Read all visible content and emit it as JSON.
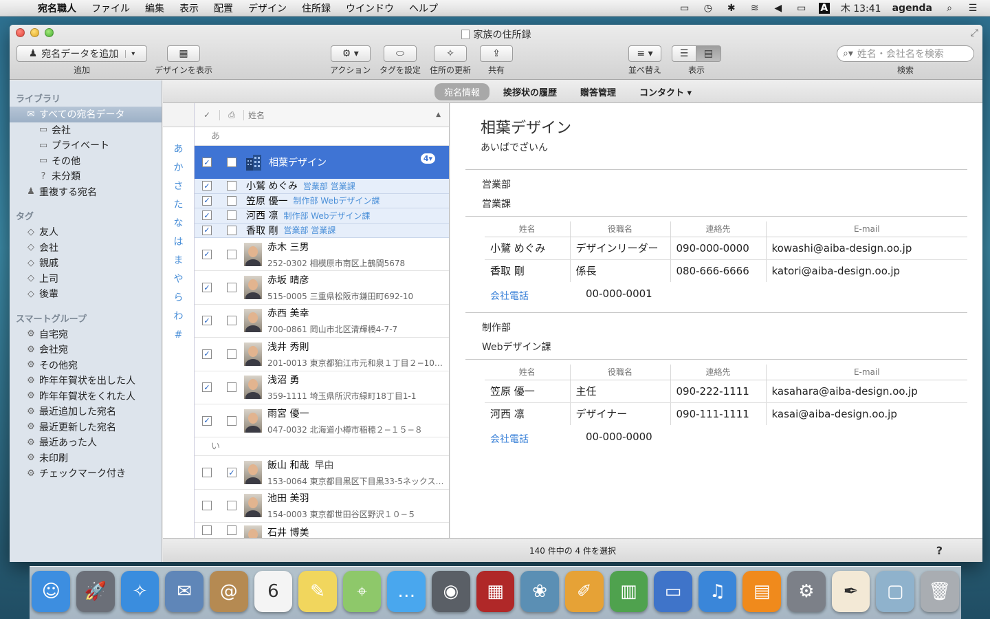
{
  "menubar": {
    "app": "宛名職人",
    "items": [
      "ファイル",
      "編集",
      "表示",
      "配置",
      "デザイン",
      "住所録",
      "ウインドウ",
      "ヘルプ"
    ],
    "clock": "木 13:41",
    "user": "agenda",
    "input_source": "A"
  },
  "window": {
    "title": "家族の住所録"
  },
  "toolbar": {
    "add_button": "宛名データを追加",
    "add_label": "追加",
    "design_label": "デザインを表示",
    "action_label": "アクション",
    "tag_label": "タグを設定",
    "update_label": "住所の更新",
    "share_label": "共有",
    "sort_label": "並べ替え",
    "view_label": "表示",
    "search_placeholder": "姓名・会社名を検索",
    "search_label": "検索"
  },
  "sidebar": {
    "library_head": "ライブラリ",
    "library": [
      {
        "label": "すべての宛名データ",
        "icon": "envelope-icon",
        "selected": true,
        "indent": 1
      },
      {
        "label": "会社",
        "icon": "folder-icon",
        "indent": 2
      },
      {
        "label": "プライベート",
        "icon": "folder-icon",
        "indent": 2
      },
      {
        "label": "その他",
        "icon": "folder-icon",
        "indent": 2
      },
      {
        "label": "未分類",
        "icon": "question-icon",
        "indent": 2
      },
      {
        "label": "重複する宛名",
        "icon": "people-icon",
        "indent": 1
      }
    ],
    "tags_head": "タグ",
    "tags": [
      "友人",
      "会社",
      "親戚",
      "上司",
      "後輩"
    ],
    "smart_head": "スマートグループ",
    "smart": [
      "自宅宛",
      "会社宛",
      "その他宛",
      "昨年年賀状を出した人",
      "昨年年賀状をくれた人",
      "最近追加した宛名",
      "最近更新した宛名",
      "最近あった人",
      "未印刷",
      "チェックマーク付き"
    ]
  },
  "tabs": [
    {
      "label": "宛名情報",
      "active": true
    },
    {
      "label": "挨拶状の履歴",
      "active": false
    },
    {
      "label": "贈答管理",
      "active": false
    },
    {
      "label": "コンタクト ▾",
      "active": false
    }
  ],
  "index": [
    "あ",
    "か",
    "さ",
    "た",
    "な",
    "は",
    "ま",
    "や",
    "ら",
    "わ",
    "#"
  ],
  "list": {
    "header_name": "姓名",
    "section_a": "あ",
    "section_i": "い",
    "selected": {
      "name": "相葉デザイン",
      "badge": "4▾",
      "checked": true
    },
    "members": [
      {
        "name": "小鷲 めぐみ",
        "dept": "営業部 営業課"
      },
      {
        "name": "笠原 優一",
        "dept": "制作部 Webデザイン課"
      },
      {
        "name": "河西 凛",
        "dept": "制作部 Webデザイン課"
      },
      {
        "name": "香取 剛",
        "dept": "営業部 営業課"
      }
    ],
    "rows_a": [
      {
        "name": "赤木 三男",
        "addr": "252-0302 相模原市南区上鶴間5678",
        "c1": true,
        "c2": false
      },
      {
        "name": "赤坂 晴彦",
        "addr": "515-0005 三重県松阪市鎌田町692-10",
        "c1": true,
        "c2": false
      },
      {
        "name": "赤西 美幸",
        "addr": "700-0861 岡山市北区清輝橋4-7-7",
        "c1": true,
        "c2": false
      },
      {
        "name": "浅井 秀則",
        "addr": "201-0013 東京都狛江市元和泉１丁目２−10…",
        "c1": true,
        "c2": false
      },
      {
        "name": "浅沼 勇",
        "addr": "359-1111 埼玉県所沢市緑町18丁目1-1",
        "c1": true,
        "c2": false
      },
      {
        "name": "雨宮 優一",
        "addr": "047-0032 北海道小樽市稲穂２−１５−８",
        "c1": true,
        "c2": false
      }
    ],
    "rows_i": [
      {
        "name": "飯山 和哉",
        "extra": "早由",
        "addr": "153-0064 東京都目黒区下目黒33-5ネックス…",
        "c1": false,
        "c2": true
      },
      {
        "name": "池田 美羽",
        "addr": "154-0003 東京都世田谷区野沢１０−５",
        "c1": false,
        "c2": false
      },
      {
        "name": "石井 博美",
        "addr": "",
        "c1": false,
        "c2": false
      }
    ]
  },
  "detail": {
    "company": "相葉デザイン",
    "kana": "あいばでざいん",
    "columns": [
      "姓名",
      "役職名",
      "連絡先",
      "E-mail"
    ],
    "phone_label": "会社電話",
    "groups": [
      {
        "dept": "営業部",
        "section": "営業課",
        "people": [
          [
            "小鷲 めぐみ",
            "デザインリーダー",
            "090-000-0000",
            "kowashi@aiba-design.oo.jp"
          ],
          [
            "香取 剛",
            "係長",
            "080-666-6666",
            "katori@aiba-design.oo.jp"
          ]
        ],
        "phone": "00-000-0001"
      },
      {
        "dept": "制作部",
        "section": "Webデザイン課",
        "people": [
          [
            "笠原 優一",
            "主任",
            "090-222-1111",
            "kasahara@aiba-design.oo.jp"
          ],
          [
            "河西 凛",
            "デザイナー",
            "090-111-1111",
            "kasai@aiba-design.oo.jp"
          ]
        ],
        "phone": "00-000-0000"
      }
    ]
  },
  "status": {
    "text": "140 件中の 4 件を選択",
    "help": "?"
  },
  "dock": [
    {
      "name": "finder-icon",
      "color": "#3d8ee0",
      "glyph": "☺"
    },
    {
      "name": "launchpad-icon",
      "color": "#6b6f78",
      "glyph": "🚀"
    },
    {
      "name": "safari-icon",
      "color": "#3a8dde",
      "glyph": "✧"
    },
    {
      "name": "mail-icon",
      "color": "#5f86b8",
      "glyph": "✉"
    },
    {
      "name": "contacts-icon",
      "color": "#b58a52",
      "glyph": "@"
    },
    {
      "name": "calendar-icon",
      "color": "#f4f4f4",
      "glyph": "6"
    },
    {
      "name": "notes-icon",
      "color": "#f1d65d",
      "glyph": "✎"
    },
    {
      "name": "maps-icon",
      "color": "#8ec86a",
      "glyph": "⌖"
    },
    {
      "name": "messages-icon",
      "color": "#49a7ee",
      "glyph": "…"
    },
    {
      "name": "facetime-icon",
      "color": "#5a5f66",
      "glyph": "◉"
    },
    {
      "name": "photobooth-icon",
      "color": "#b02828",
      "glyph": "▦"
    },
    {
      "name": "iphoto-icon",
      "color": "#5b8fb4",
      "glyph": "❀"
    },
    {
      "name": "pages-icon",
      "color": "#e6a236",
      "glyph": "✐"
    },
    {
      "name": "numbers-icon",
      "color": "#4fa24e",
      "glyph": "▥"
    },
    {
      "name": "keynote-icon",
      "color": "#3f74c9",
      "glyph": "▭"
    },
    {
      "name": "itunes-icon",
      "color": "#3a86d9",
      "glyph": "♫"
    },
    {
      "name": "ibooks-icon",
      "color": "#f08a1c",
      "glyph": "▤"
    },
    {
      "name": "system-preferences-icon",
      "color": "#7c8088",
      "glyph": "⚙"
    },
    {
      "name": "atena-shokunin-icon",
      "color": "#f3e9d6",
      "glyph": "✒"
    },
    {
      "name": "applications-folder-icon",
      "color": "#8fb2cc",
      "glyph": "▢"
    },
    {
      "name": "trash-icon",
      "color": "#a9adb2",
      "glyph": "🗑"
    }
  ]
}
